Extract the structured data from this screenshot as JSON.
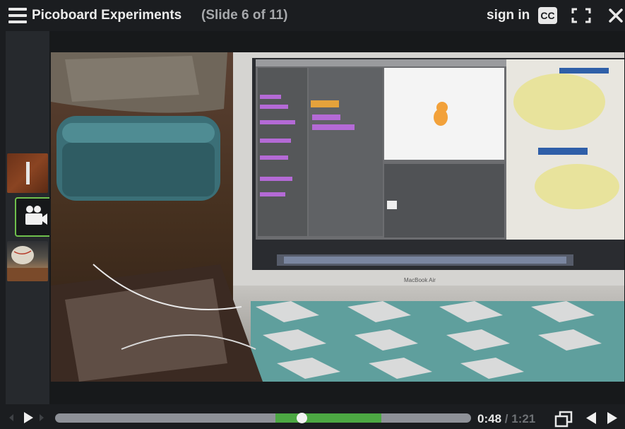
{
  "header": {
    "title": "Picoboard Experiments",
    "slide_indicator": "(Slide 6 of 11)",
    "sign_in": "sign in",
    "cc_label": "CC",
    "icons": [
      "menu-icon",
      "closed-captions-icon",
      "fullscreen-icon",
      "close-icon"
    ]
  },
  "sidebar": {
    "thumbnails": [
      {
        "name": "slide-thumbnail-text",
        "active": false
      },
      {
        "name": "slide-thumbnail-video",
        "active": true,
        "icon": "video-camera-icon"
      },
      {
        "name": "slide-thumbnail-image",
        "active": false
      }
    ]
  },
  "player": {
    "current_time": "0:48",
    "separator": "/",
    "total_time": "1:21",
    "progress_fraction": 0.593,
    "played_segment_fraction": [
      0.53,
      0.785
    ],
    "colors": {
      "accent": "#4ca843",
      "track": "#8e9198",
      "background": "#1b1d20"
    },
    "icons": [
      "skip-back-icon",
      "play-icon",
      "skip-forward-icon",
      "popout-icon",
      "previous-slide-icon",
      "next-slide-icon"
    ]
  },
  "video": {
    "laptop_brand": "MacBook Air"
  }
}
